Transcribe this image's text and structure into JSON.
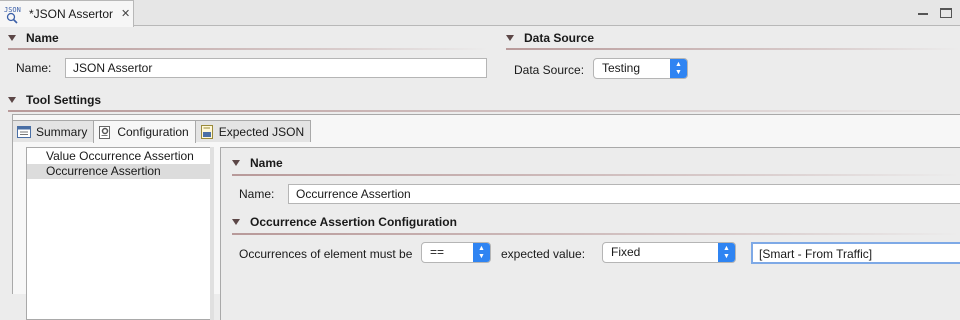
{
  "editor_tab": {
    "icon_text": "JSON",
    "title": "*JSON Assertor",
    "close": "✕"
  },
  "window_controls": {
    "minimize": "minimize-icon",
    "maximize": "maximize-icon"
  },
  "name_section": {
    "title": "Name",
    "name_label": "Name:",
    "name_value": "JSON Assertor"
  },
  "data_source_section": {
    "title": "Data Source",
    "label": "Data Source:",
    "value": "Testing"
  },
  "tool_settings": {
    "title": "Tool Settings",
    "tabs": [
      {
        "label": "Summary",
        "icon": "summary-icon"
      },
      {
        "label": "Configuration",
        "icon": "configuration-icon",
        "active": true
      },
      {
        "label": "Expected JSON",
        "icon": "expected-json-icon"
      }
    ],
    "list_items": [
      "Value Occurrence Assertion",
      "Occurrence Assertion"
    ],
    "selected_item": "Occurrence Assertion"
  },
  "detail": {
    "name_title": "Name",
    "name_label": "Name:",
    "name_value": "Occurrence Assertion",
    "config_title": "Occurrence Assertion Configuration",
    "occurrences_label": "Occurrences of element must be",
    "operator_value": "==",
    "expected_label": "expected value:",
    "expected_mode": "Fixed",
    "expected_value": "[Smart - From Traffic]"
  },
  "colors": {
    "accent": "#2f84f2",
    "section_rule": "#b89a9a",
    "triangle": "#5c4747"
  }
}
